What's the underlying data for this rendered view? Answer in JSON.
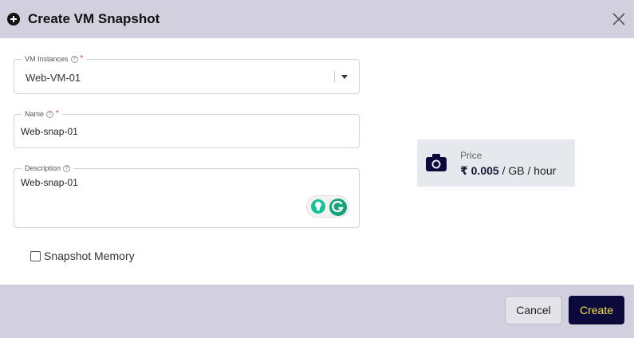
{
  "dialog": {
    "title": "Create VM Snapshot"
  },
  "form": {
    "vm_instances": {
      "label": "VM Instances",
      "required_mark": "*",
      "selected": "Web-VM-01"
    },
    "name": {
      "label": "Name",
      "required_mark": "*",
      "value": "Web-snap-01"
    },
    "description": {
      "label": "Description",
      "value": "Web-snap-01"
    },
    "snapshot_memory": {
      "label": "Snapshot Memory",
      "checked": false
    }
  },
  "price": {
    "label": "Price",
    "currency": "₹",
    "amount": "0.005",
    "unit": "/ GB / hour"
  },
  "footer": {
    "cancel_label": "Cancel",
    "create_label": "Create"
  },
  "icons": {
    "header": "plus-circle-icon",
    "close": "close-icon",
    "help": "help-icon",
    "dropdown": "caret-down-icon",
    "price": "camera-icon"
  },
  "colors": {
    "header_bg": "#d2d0de",
    "primary_button_bg": "#0b0a3a",
    "primary_button_text": "#f5e04a",
    "required": "#d32f2f",
    "price_card_bg": "#e5e8ec"
  }
}
